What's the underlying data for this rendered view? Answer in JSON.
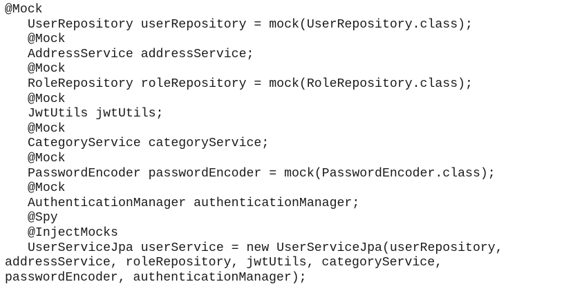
{
  "code": {
    "lines": [
      {
        "text": "@Mock",
        "indent": false
      },
      {
        "text": "UserRepository userRepository = mock(UserRepository.class);",
        "indent": true
      },
      {
        "text": "@Mock",
        "indent": true
      },
      {
        "text": "AddressService addressService;",
        "indent": true
      },
      {
        "text": "@Mock",
        "indent": true
      },
      {
        "text": "RoleRepository roleRepository = mock(RoleRepository.class);",
        "indent": true
      },
      {
        "text": "@Mock",
        "indent": true
      },
      {
        "text": "JwtUtils jwtUtils;",
        "indent": true
      },
      {
        "text": "@Mock",
        "indent": true
      },
      {
        "text": "CategoryService categoryService;",
        "indent": true
      },
      {
        "text": "@Mock",
        "indent": true
      },
      {
        "text": "PasswordEncoder passwordEncoder = mock(PasswordEncoder.class);",
        "indent": true
      },
      {
        "text": "@Mock",
        "indent": true
      },
      {
        "text": "AuthenticationManager authenticationManager;",
        "indent": true
      },
      {
        "text": "@Spy",
        "indent": true
      },
      {
        "text": "@InjectMocks",
        "indent": true
      },
      {
        "text": "UserServiceJpa userService = new UserServiceJpa(userRepository,",
        "indent": true
      },
      {
        "text": "addressService, roleRepository, jwtUtils, categoryService,",
        "indent": false
      },
      {
        "text": "passwordEncoder, authenticationManager);",
        "indent": false
      }
    ]
  }
}
